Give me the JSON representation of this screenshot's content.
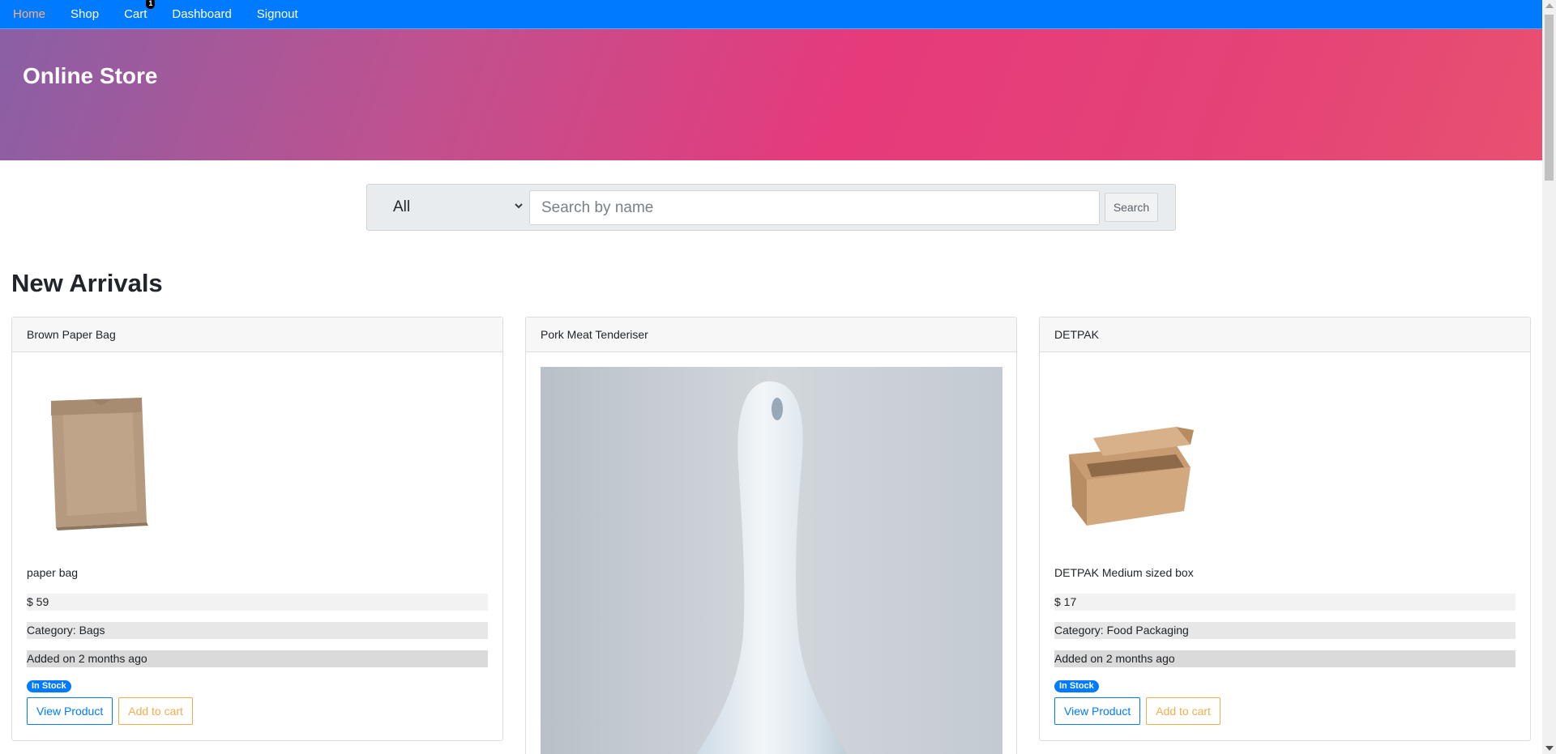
{
  "nav": {
    "items": [
      {
        "label": "Home",
        "active": true
      },
      {
        "label": "Shop"
      },
      {
        "label": "Cart",
        "badge": "1"
      },
      {
        "label": "Dashboard"
      },
      {
        "label": "Signout"
      }
    ]
  },
  "hero": {
    "title": "Online Store"
  },
  "search": {
    "category_selected": "All",
    "placeholder": "Search by name",
    "value": "",
    "button_label": "Search"
  },
  "section": {
    "title": "New Arrivals"
  },
  "products": [
    {
      "name": "Brown Paper Bag",
      "description": "paper bag",
      "price": "$ 59",
      "category": "Category: Bags",
      "added": "Added on 2 months ago",
      "stock": "In Stock",
      "view_label": "View Product",
      "cart_label": "Add to cart",
      "icon": "paper-bag-image"
    },
    {
      "name": "Pork Meat Tenderiser",
      "icon": "meat-tenderiser-image"
    },
    {
      "name": "DETPAK",
      "description": "DETPAK Medium sized box",
      "price": "$ 17",
      "category": "Category: Food Packaging",
      "added": "Added on 2 months ago",
      "stock": "In Stock",
      "view_label": "View Product",
      "cart_label": "Add to cart",
      "icon": "food-box-image"
    }
  ],
  "colors": {
    "navbar": "#007bff",
    "active_link": "#ffb07a",
    "badge": "#007bff",
    "add_to_cart": "#f0ad4e"
  }
}
